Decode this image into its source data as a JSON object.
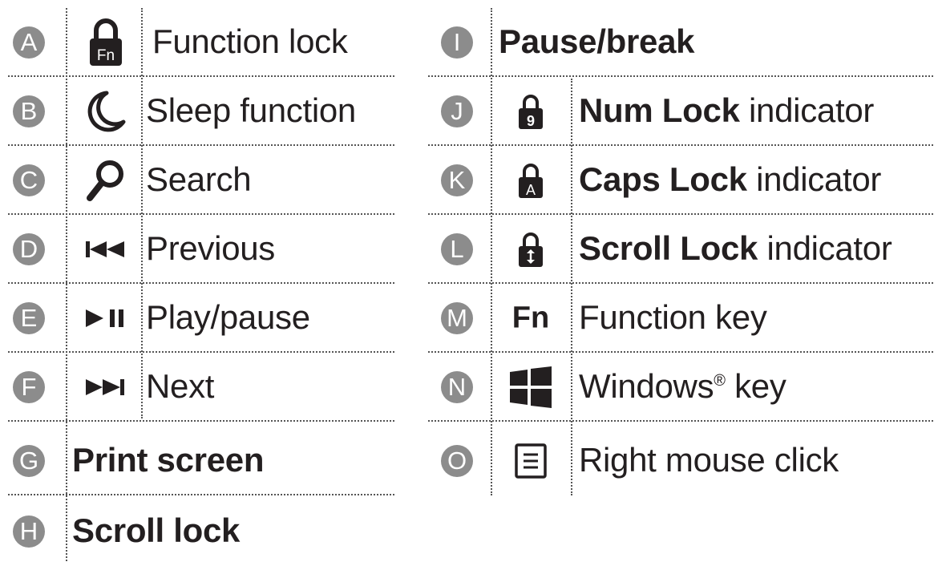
{
  "left_column": [
    {
      "letter": "A",
      "icon": "fn-lock-icon",
      "label": "Function lock"
    },
    {
      "letter": "B",
      "icon": "moon-icon",
      "label": "Sleep function"
    },
    {
      "letter": "C",
      "icon": "search-icon",
      "label": "Search"
    },
    {
      "letter": "D",
      "icon": "previous-track-icon",
      "label": "Previous"
    },
    {
      "letter": "E",
      "icon": "play-pause-icon",
      "label": "Play/pause"
    },
    {
      "letter": "F",
      "icon": "next-track-icon",
      "label": "Next"
    },
    {
      "letter": "G",
      "label": "Print screen"
    },
    {
      "letter": "H",
      "label": "Scroll lock"
    }
  ],
  "right_column": [
    {
      "letter": "I",
      "label": "Pause/break"
    },
    {
      "letter": "J",
      "icon": "num-lock-icon",
      "icon_glyph": "9",
      "label_bold": "Num Lock",
      "label_rest": " indicator"
    },
    {
      "letter": "K",
      "icon": "caps-lock-icon",
      "icon_glyph": "A",
      "label_bold": "Caps Lock",
      "label_rest": " indicator"
    },
    {
      "letter": "L",
      "icon": "scroll-lock-icon",
      "label_bold": "Scroll Lock",
      "label_rest": " indicator"
    },
    {
      "letter": "M",
      "icon": "fn-key-icon",
      "icon_text": "Fn",
      "label": "Function key"
    },
    {
      "letter": "N",
      "icon": "windows-logo-icon",
      "label": "Windows",
      "label_sup": "®",
      "label_after": " key"
    },
    {
      "letter": "O",
      "icon": "context-menu-icon",
      "label": "Right mouse click"
    }
  ],
  "fn_lock_glyph": "Fn",
  "colors": {
    "badge": "#8c8c8c",
    "text": "#231f20",
    "separator": "#555555"
  }
}
